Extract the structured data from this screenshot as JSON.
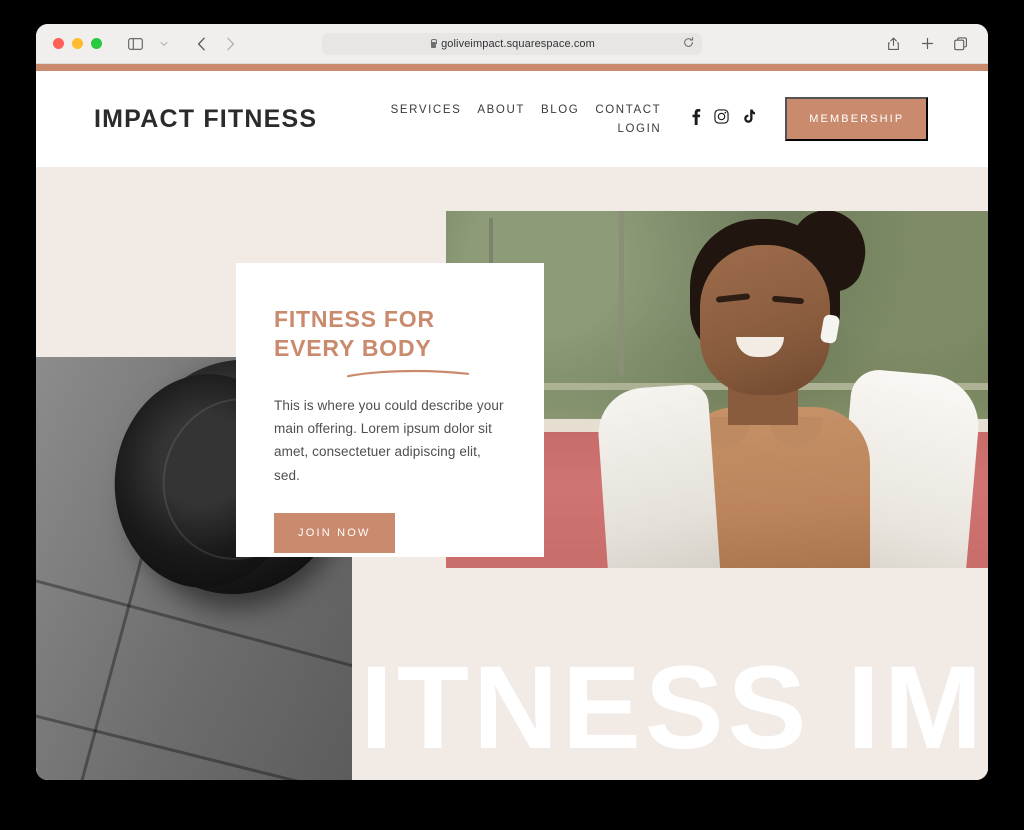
{
  "browser": {
    "url": "goliveimpact.squarespace.com",
    "lock_icon": "lock-icon",
    "reload_icon": "reload-icon",
    "sidebar_icon": "sidebar-toggle-icon",
    "chevron_icon": "chevron-down-icon",
    "back_icon": "back-arrow-icon",
    "forward_icon": "forward-arrow-icon",
    "share_icon": "share-icon",
    "new_tab_icon": "plus-icon",
    "tabs_icon": "tab-overview-icon",
    "traffic_lights": [
      "close",
      "minimize",
      "maximize"
    ]
  },
  "site": {
    "accent_color": "#ca8a6d",
    "background_color": "#f2eae5",
    "brand": "IMPACT FITNESS",
    "nav": [
      {
        "label": "SERVICES"
      },
      {
        "label": "ABOUT"
      },
      {
        "label": "BLOG"
      },
      {
        "label": "CONTACT"
      },
      {
        "label": "LOGIN"
      }
    ],
    "socials": [
      {
        "name": "facebook-icon"
      },
      {
        "name": "instagram-icon"
      },
      {
        "name": "tiktok-icon"
      }
    ],
    "membership_label": "MEMBERSHIP"
  },
  "hero": {
    "card": {
      "title_line1": "FITNESS FOR",
      "title_line2": "EVERY BODY",
      "body": "This is where you could describe your main offering. Lorem ipsum dolor sit amet, consectetuer adipiscing elit, sed.",
      "cta_label": "JOIN NOW"
    },
    "big_word": "FITNESS IMPACT",
    "portrait_alt": "smiling-woman-in-sportswear-photo",
    "barbell_alt": "barbell-weight-plate-photo"
  }
}
